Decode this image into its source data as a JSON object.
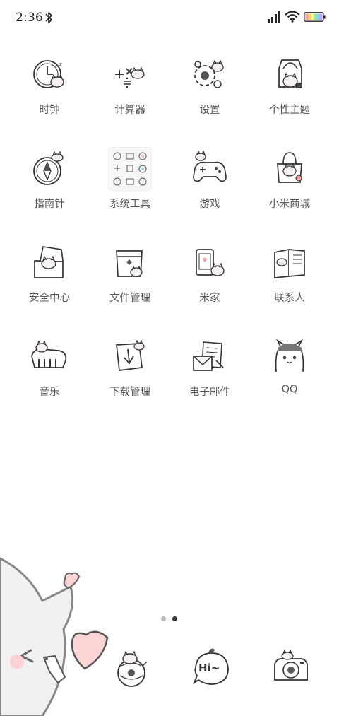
{
  "status_bar": {
    "time": "2:36",
    "icons": [
      "bluetooth-icon",
      "signal-icon",
      "wifi-icon",
      "battery-icon"
    ]
  },
  "apps": [
    {
      "label": "时钟",
      "icon": "clock-icon"
    },
    {
      "label": "计算器",
      "icon": "calculator-icon"
    },
    {
      "label": "设置",
      "icon": "settings-icon"
    },
    {
      "label": "个性主题",
      "icon": "themes-icon"
    },
    {
      "label": "指南针",
      "icon": "compass-icon"
    },
    {
      "label": "系统工具",
      "icon": "folder-icon"
    },
    {
      "label": "游戏",
      "icon": "gamepad-icon"
    },
    {
      "label": "小米商城",
      "icon": "shopping-bag-icon"
    },
    {
      "label": "安全中心",
      "icon": "security-box-icon"
    },
    {
      "label": "文件管理",
      "icon": "file-manager-icon"
    },
    {
      "label": "米家",
      "icon": "smart-home-icon"
    },
    {
      "label": "联系人",
      "icon": "contacts-book-icon"
    },
    {
      "label": "音乐",
      "icon": "music-icon"
    },
    {
      "label": "下载管理",
      "icon": "download-icon"
    },
    {
      "label": "电子邮件",
      "icon": "email-icon"
    },
    {
      "label": "QQ",
      "icon": "qq-icon"
    }
  ],
  "page_indicator": {
    "total": 2,
    "active": 2
  },
  "dock": {
    "items": [
      {
        "icon": "phone-cat-icon"
      },
      {
        "icon": "messages-hi-icon"
      },
      {
        "icon": "camera-icon"
      }
    ],
    "hi_text": "Hi~"
  },
  "colors": {
    "text": "#555555",
    "heart": "#fcd4d6",
    "dot_active": "#333333",
    "dot_inactive": "#bbbbbb"
  }
}
